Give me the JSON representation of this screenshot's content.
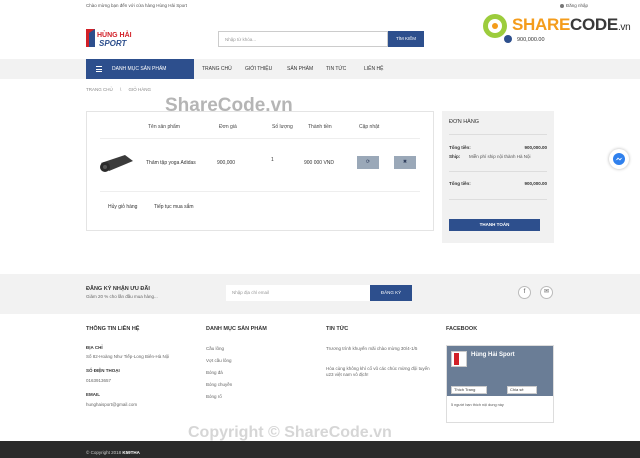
{
  "topbar": {
    "welcome": "Chào mừng bạn đến với cửa hàng Hùng Hải Sport",
    "login": "Đăng nhập"
  },
  "brand": {
    "logo_line1": "HÙNG HẢI",
    "logo_line2": "SPORT",
    "accent": "#2d4f8d",
    "logo_red": "#d22027"
  },
  "search": {
    "placeholder": "Nhập từ khóa...",
    "button": "TÌM KIẾM"
  },
  "sharecode": {
    "name_share": "SHARE",
    "name_code": "CODE",
    "tld": ".vn"
  },
  "cart_total": "900,000.00",
  "nav": {
    "category_button": "DANH MỤC SẢN PHẨM",
    "items": [
      "TRANG CHỦ",
      "GIỚI THIỆU",
      "SẢN PHẨM",
      "TIN TỨC",
      "LIÊN HỆ"
    ]
  },
  "breadcrumb": {
    "home": "TRANG CHỦ",
    "sep": "\\",
    "current": "GIỎ HÀNG"
  },
  "cart": {
    "headers": [
      "Tên sản phẩm",
      "Đơn giá",
      "Số lượng",
      "Thành tiền",
      "Cập nhật"
    ],
    "rows": [
      {
        "name": "Thảm tập yoga Adidas",
        "price": "900,000",
        "qty": "1",
        "total": "900 000 VND",
        "update_icon": "refresh-icon",
        "delete_icon": "close-icon"
      }
    ],
    "cancel_link": "Hủy giỏ hàng",
    "continue_link": "Tiếp tục mua sắm"
  },
  "order": {
    "title": "ĐƠN HÀNG",
    "subtotal_label": "Tổng tiền:",
    "subtotal_value": "900,000.00",
    "ship_label": "Ship:",
    "ship_value": "Miễn phí ship nội thành Hà Nội",
    "total_label": "Tổng tiền:",
    "total_value": "900,000.00",
    "pay_button": "THANH TOÁN"
  },
  "newsletter": {
    "title": "ĐĂNG KÝ NHẬN ƯU ĐÃI",
    "subtitle": "Giảm 20 % cho lần đầu mua hàng...",
    "placeholder": "Nhập địa chỉ email",
    "button": "ĐĂNG KÝ",
    "social": [
      "f",
      "✉"
    ]
  },
  "footer": {
    "contact": {
      "heading": "THÔNG TIN LIÊN HỆ",
      "address_label": "ĐỊA CHỈ",
      "address": "Số 82-Hoàng Như Tiếp-Long Biên-Hà Nội",
      "phone_label": "SỐ ĐIỆN THOẠI",
      "phone": "0163913657",
      "email_label": "EMAIL",
      "email": "hunghaisport@gmail.com"
    },
    "categories": {
      "heading": "DANH MỤC SẢN PHẨM",
      "items": [
        "Cầu lông",
        "Vợt cầu lông",
        "Bóng đá",
        "Bóng chuyền",
        "Bóng rổ"
      ]
    },
    "news": {
      "heading": "TIN TỨC",
      "items": [
        "Trương trình khuyến mãi chào mừng 30/4-1/5",
        "Hòa cùng không khí cổ vũ các chúc mừng đội tuyển u23 việt nam vô địch!"
      ]
    },
    "facebook": {
      "heading": "FACEBOOK",
      "page_name": "Hùng Hải Sport",
      "like_button": "Thích Trang",
      "share_button": "Chia sẻ",
      "friends_text": "5 người bạn thích nội dung này"
    }
  },
  "copyright": {
    "text": "© Copyright 2018",
    "brand": "K59THA"
  },
  "watermarks": {
    "center": "ShareCode.vn",
    "bottom": "Copyright © ShareCode.vn"
  }
}
